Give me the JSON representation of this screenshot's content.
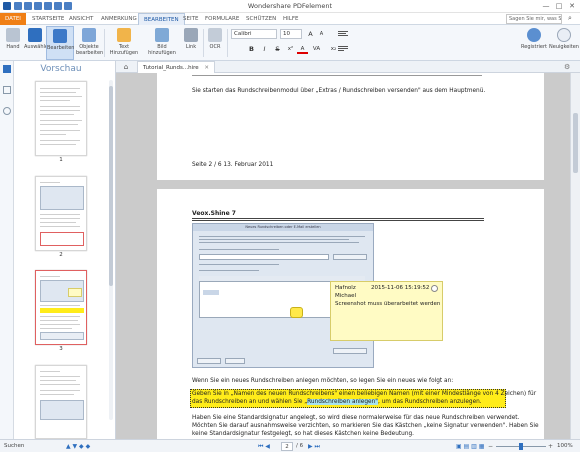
{
  "window": {
    "title": "Wondershare PDFelement",
    "minimize": "—",
    "maximize": "□",
    "close": "✕",
    "search_placeholder": "Sagen Sie mir, was Sie tun möchten"
  },
  "ribbon_tabs": [
    "DATEI",
    "STARTSEITE",
    "ANSICHT",
    "ANMERKUNG",
    "BEARBEITEN",
    "SEITE",
    "FORMULARE",
    "SCHÜTZEN",
    "HILFE"
  ],
  "tools": {
    "hand": "Hand",
    "select": "Auswählen",
    "edit": "Bearbeiten",
    "edit_objects": "Objekte bearbeiten",
    "add_text": "Text Hinzufügen",
    "add_image": "Bild hinzufügen",
    "link": "Link",
    "ocr": "OCR",
    "register": "Registriert",
    "news": "Neuigkeiten"
  },
  "font": {
    "name": "Calibri",
    "size": "10"
  },
  "format": {
    "increase": "A",
    "decrease": "A",
    "bold": "B",
    "italic": "I",
    "strike": "S",
    "superscript": "x²",
    "subscript": "x₂",
    "color": "A",
    "spacing": "VA"
  },
  "sidebar": {
    "title": "Vorschau",
    "thumbs": [
      "1",
      "2",
      "3"
    ]
  },
  "doc_tab": {
    "label": "Tutorial_Runds...hire",
    "close": "✕",
    "new": "+"
  },
  "page1": {
    "line": "Sie starten das Rundschreibenmodul über „Extras / Rundschreiben versenden\" aus dem Hauptmenü.",
    "footer": "Seite 2 / 6    13. Februar 2011"
  },
  "page2": {
    "header": "Veox.Shine 7",
    "dialog_title": "Neues Rundschreiben oder E-Mail erstellen",
    "para1": "Wenn Sie ein neues Rundschreiben anlegen möchten, so legen Sie ein neues wie folgt an:",
    "hl_a": "Geben Sie in „Namen des neuen Rundschreibens\" einen beliebigen Namen (mit einer Mindestlänge von 4 Zeichen) für",
    "hl_b1": "das Rundschreiben an und wählen Sie „",
    "hl_b2": "Rundschreiben anlegen\"",
    "hl_b3": ", um das Rundschreiben anzulegen.",
    "para2": "Haben Sie eine Standardsignatur angelegt, so wird diese normalerweise für das neue Rundschreiben verwendet.",
    "para3": "Möchten Sie darauf ausnahmsweise verzichten, so markieren Sie das Kästchen „keine Signatur verwenden\". Haben Sie",
    "para4": "keine Standardsignatur festgelegt, so hat dieses Kästchen keine Bedeutung."
  },
  "note": {
    "author": "Hafnolz",
    "user": "Michael",
    "datetime": "2015-11-06 15:19:52",
    "text": "Screenshot muss überarbeitet werden"
  },
  "status": {
    "search": "Suchen",
    "page_current": "2",
    "page_total": "/ 6",
    "zoom": "100%"
  },
  "colors": {
    "accent": "#2f6fbf",
    "file_tab": "#f07f15",
    "highlight": "#ffec1a",
    "note_bg": "#fffbc4"
  }
}
